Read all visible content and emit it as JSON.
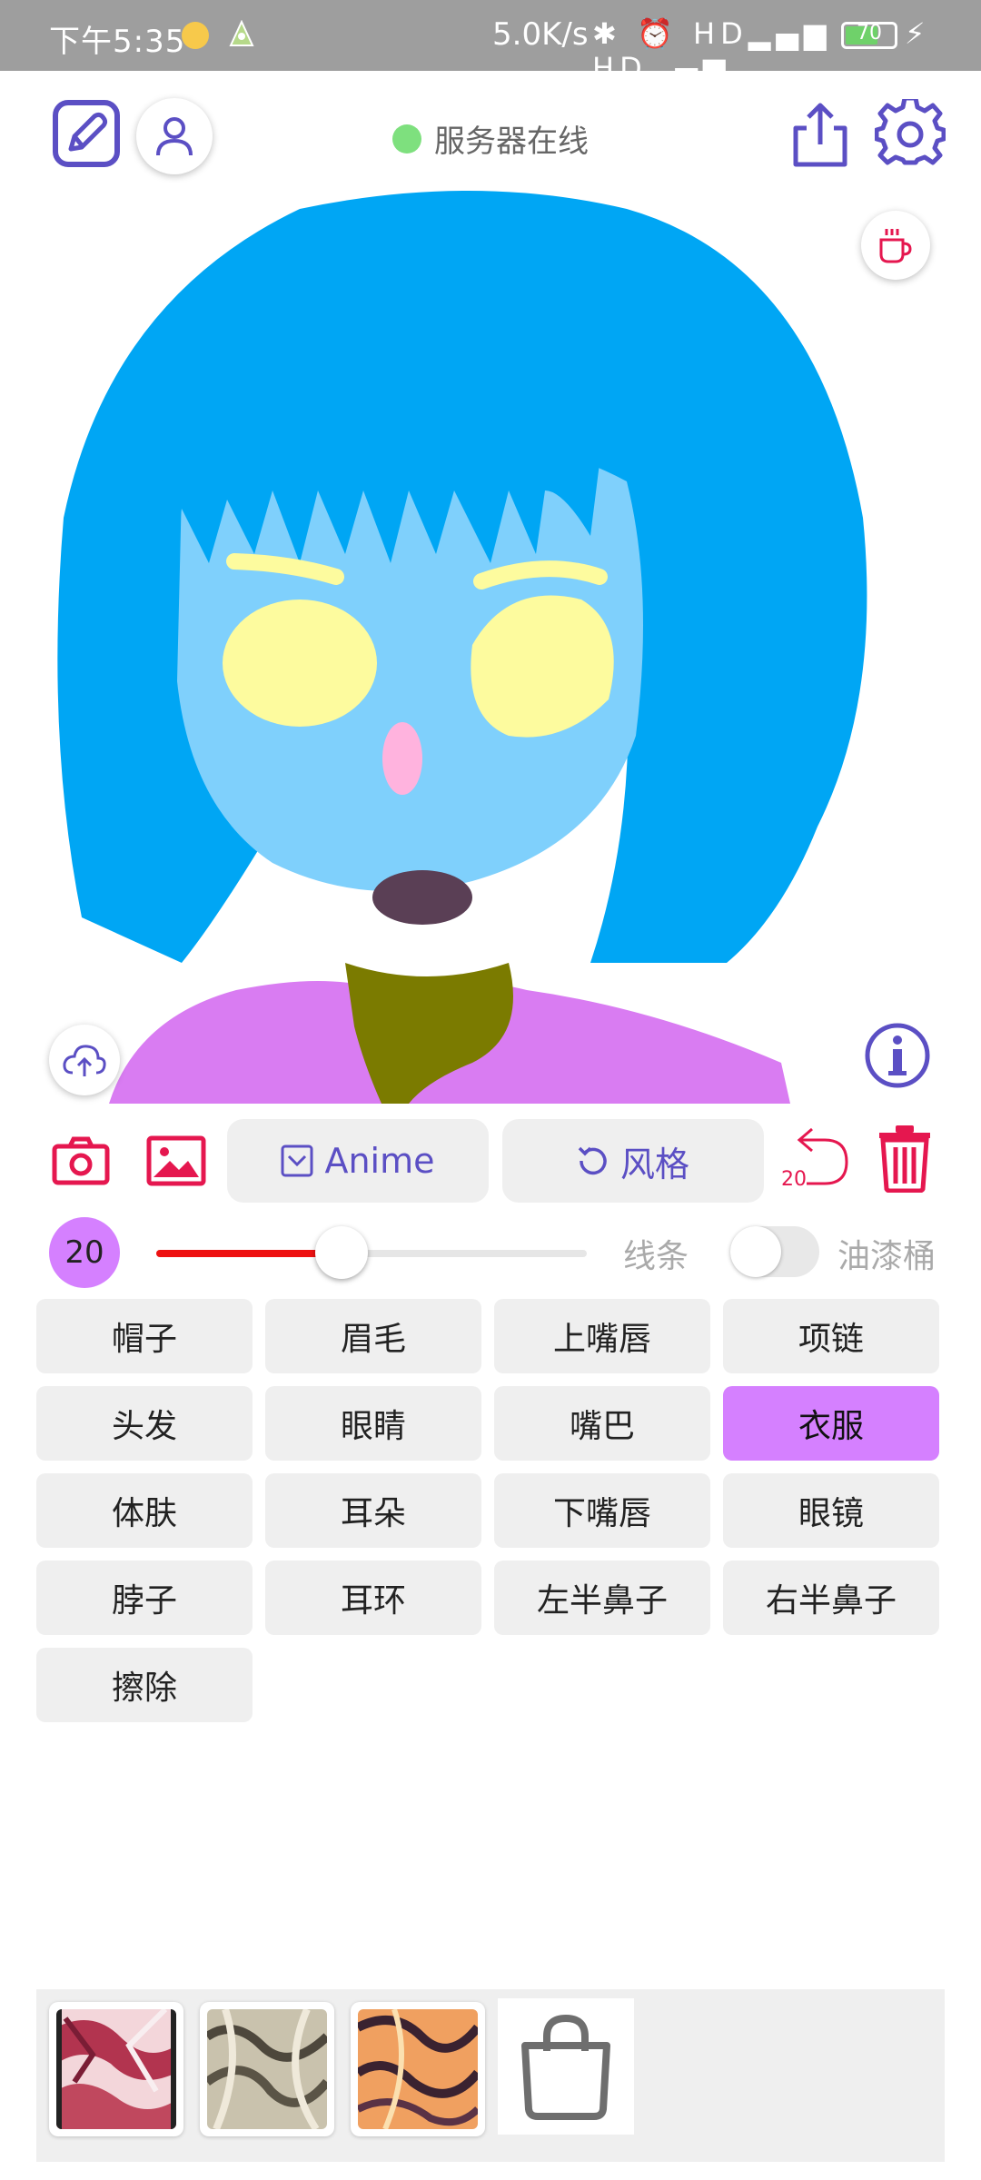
{
  "status_bar": {
    "time": "下午5:35",
    "net_speed": "5.0K/s",
    "icons": "✱ ⏰ HD▂▄▆ HD▂▄▆ ",
    "battery_level": "70",
    "charging_icon": "⚡"
  },
  "header": {
    "server_status": "服务器在线",
    "server_status_color": "#7ee07e"
  },
  "toolbar": {
    "model_label": "Anime",
    "style_label": "风格",
    "undo_count": "20"
  },
  "brush": {
    "size": "20",
    "slider_fraction": 0.43,
    "line_label": "线条",
    "bucket_label": "油漆桶",
    "bucket_enabled": false,
    "color": "#ee1111"
  },
  "parts": [
    {
      "label": "帽子",
      "selected": false
    },
    {
      "label": "眉毛",
      "selected": false
    },
    {
      "label": "上嘴唇",
      "selected": false
    },
    {
      "label": "项链",
      "selected": false
    },
    {
      "label": "头发",
      "selected": false
    },
    {
      "label": "眼睛",
      "selected": false
    },
    {
      "label": "嘴巴",
      "selected": false
    },
    {
      "label": "衣服",
      "selected": true
    },
    {
      "label": "体肤",
      "selected": false
    },
    {
      "label": "耳朵",
      "selected": false
    },
    {
      "label": "下嘴唇",
      "selected": false
    },
    {
      "label": "眼镜",
      "selected": false
    },
    {
      "label": "脖子",
      "selected": false
    },
    {
      "label": "耳环",
      "selected": false
    },
    {
      "label": "左半鼻子",
      "selected": false
    },
    {
      "label": "右半鼻子",
      "selected": false
    },
    {
      "label": "擦除",
      "selected": false
    }
  ],
  "palette": {
    "accent": "#5b4fc4",
    "danger": "#e5174f",
    "selected_part": "#d580ff",
    "hair": "#00a6f4",
    "skin": "#7fd0fc",
    "eyes": "#fdfb9e",
    "nose": "#ffb3de",
    "mouth": "#5a3f55",
    "neck": "#7b7b00",
    "clothes": "#d97cf2"
  },
  "icons": {
    "edit": "edit-icon",
    "user": "user-icon",
    "share": "share-icon",
    "settings": "gear-icon",
    "coffee": "coffee-icon",
    "upload": "cloud-upload-icon",
    "info": "info-icon",
    "camera": "camera-icon",
    "gallery": "image-icon",
    "undo": "undo-icon",
    "trash": "trash-icon",
    "shop": "shopping-bag-icon"
  }
}
